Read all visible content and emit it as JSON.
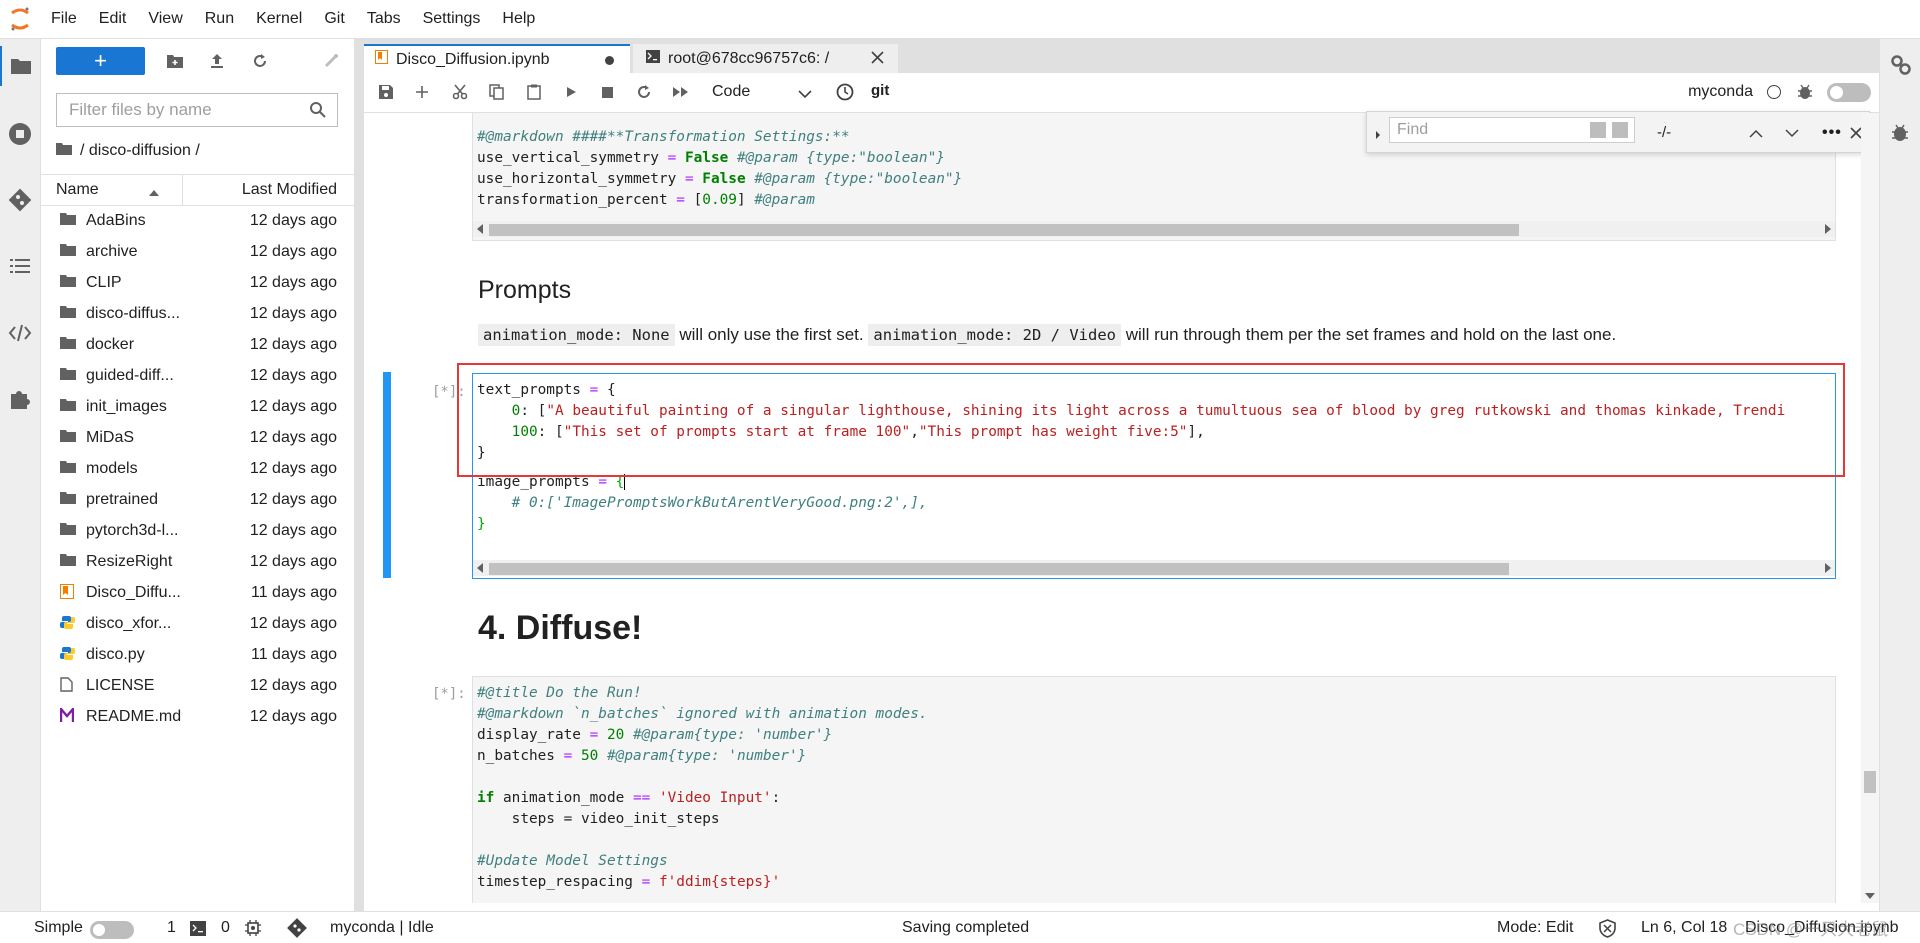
{
  "menubar": {
    "items": [
      "File",
      "Edit",
      "View",
      "Run",
      "Kernel",
      "Git",
      "Tabs",
      "Settings",
      "Help"
    ]
  },
  "filebrowser": {
    "new_button": "+",
    "filter_placeholder": "Filter files by name",
    "breadcrumb": "/ disco-diffusion /",
    "col_name": "Name",
    "col_modified": "Last Modified",
    "files": [
      {
        "name": "AdaBins",
        "modified": "12 days ago",
        "type": "folder"
      },
      {
        "name": "archive",
        "modified": "12 days ago",
        "type": "folder"
      },
      {
        "name": "CLIP",
        "modified": "12 days ago",
        "type": "folder"
      },
      {
        "name": "disco-diffus...",
        "modified": "12 days ago",
        "type": "folder"
      },
      {
        "name": "docker",
        "modified": "12 days ago",
        "type": "folder"
      },
      {
        "name": "guided-diff...",
        "modified": "12 days ago",
        "type": "folder"
      },
      {
        "name": "init_images",
        "modified": "12 days ago",
        "type": "folder"
      },
      {
        "name": "MiDaS",
        "modified": "12 days ago",
        "type": "folder"
      },
      {
        "name": "models",
        "modified": "12 days ago",
        "type": "folder"
      },
      {
        "name": "pretrained",
        "modified": "12 days ago",
        "type": "folder"
      },
      {
        "name": "pytorch3d-l...",
        "modified": "12 days ago",
        "type": "folder"
      },
      {
        "name": "ResizeRight",
        "modified": "12 days ago",
        "type": "folder"
      },
      {
        "name": "Disco_Diffu...",
        "modified": "11 days ago",
        "type": "notebook"
      },
      {
        "name": "disco_xfor...",
        "modified": "12 days ago",
        "type": "python"
      },
      {
        "name": "disco.py",
        "modified": "11 days ago",
        "type": "python"
      },
      {
        "name": "LICENSE",
        "modified": "12 days ago",
        "type": "file"
      },
      {
        "name": "README.md",
        "modified": "12 days ago",
        "type": "markdown"
      }
    ]
  },
  "tabs": [
    {
      "label": "Disco_Diffusion.ipynb",
      "active": true
    },
    {
      "label": "root@678cc96757c6: /",
      "active": false
    }
  ],
  "toolbar": {
    "cell_type": "Code",
    "git_label": "git",
    "kernel_name": "myconda"
  },
  "find": {
    "placeholder": "Find",
    "result": "-/-"
  },
  "notebook": {
    "cell1_lines_partial": "{",
    "cell1": {
      "line1": "#@markdown ####**Transformation Settings:**",
      "line2_var": "use_vertical_symmetry",
      "line2_val": "False",
      "line2_cm": "#@param {type:\"boolean\"}",
      "line3_var": "use_horizontal_symmetry",
      "line3_val": "False",
      "line3_cm": "#@param {type:\"boolean\"}",
      "line4_var": "transformation_percent",
      "line4_val": "0.09",
      "line4_cm": "#@param"
    },
    "prompts_heading": "Prompts",
    "prompts_code1": "animation_mode: None",
    "prompts_text1": "will only use the first set.",
    "prompts_code2": "animation_mode: 2D / Video",
    "prompts_text2": "will run through them per the set frames and hold on the last one.",
    "cell2_prompt": "[*]:",
    "cell2": {
      "l1_var": "text_prompts",
      "l2_key": "0",
      "l2_str": "\"A beautiful painting of a singular lighthouse, shining its light across a tumultuous sea of blood by greg rutkowski and thomas kinkade, Trendi",
      "l3_key": "100",
      "l3_str1": "\"This set of prompts start at frame 100\"",
      "l3_str2": "\"This prompt has weight five:5\"",
      "l5_var": "image_prompts",
      "l6_cm": "# 0:['ImagePromptsWorkButArentVeryGood.png:2',],"
    },
    "diffuse_heading": "4. Diffuse!",
    "cell3_prompt": "[*]:",
    "cell3": {
      "l1": "#@title Do the Run!",
      "l2": "#@markdown `n_batches` ignored with animation modes.",
      "l3_var": "display_rate",
      "l3_val": "20",
      "l3_cm": "#@param{type: 'number'}",
      "l4_var": "n_batches",
      "l4_val": "50",
      "l4_cm": "#@param{type: 'number'}",
      "l6_str": "'Video Input'",
      "l7": "    steps = video_init_steps",
      "l9": "#Update Model Settings",
      "l10_var": "timestep_respacing",
      "l10_str": "f'ddim{steps}'"
    }
  },
  "statusbar": {
    "simple_label": "Simple",
    "terminals": "1",
    "kernels": "0",
    "kernel_status": "myconda | Idle",
    "saving": "Saving completed",
    "mode": "Mode: Edit",
    "position": "Ln 6, Col 18",
    "filename": "Disco_Diffusion.ipynb",
    "watermark": "CSDN @一只大老鼠"
  },
  "colors": {
    "accent": "#1976d2",
    "highlight_box": "#e53935",
    "cell_active": "#2196f3"
  }
}
